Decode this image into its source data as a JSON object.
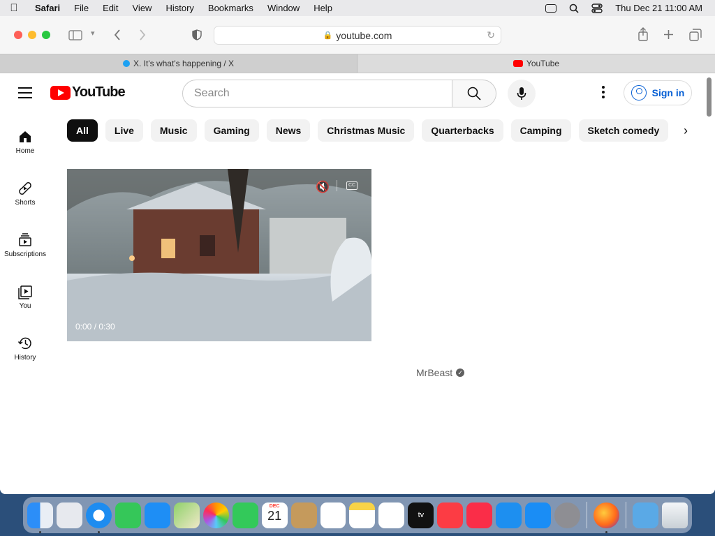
{
  "menubar": {
    "app": "Safari",
    "items": [
      "File",
      "Edit",
      "View",
      "History",
      "Bookmarks",
      "Window",
      "Help"
    ],
    "clock": "Thu Dec 21  11:00 AM"
  },
  "browser": {
    "url": "youtube.com",
    "tabs": [
      {
        "label": "X. It's what's happening / X",
        "active": false
      },
      {
        "label": "YouTube",
        "active": true
      }
    ]
  },
  "youtube": {
    "logo_text": "YouTube",
    "search_placeholder": "Search",
    "signin_label": "Sign in",
    "chips": [
      "All",
      "Live",
      "Music",
      "Gaming",
      "News",
      "Christmas Music",
      "Quarterbacks",
      "Camping",
      "Sketch comedy"
    ],
    "sidebar": [
      {
        "label": "Home",
        "icon": "home-icon"
      },
      {
        "label": "Shorts",
        "icon": "shorts-icon"
      },
      {
        "label": "Subscriptions",
        "icon": "subscriptions-icon"
      },
      {
        "label": "You",
        "icon": "you-icon"
      },
      {
        "label": "History",
        "icon": "history-icon"
      }
    ],
    "video": {
      "timecode": "0:00 / 0:30",
      "channel": "MrBeast"
    }
  },
  "dock": [
    "Finder",
    "Launchpad",
    "Safari",
    "Messages",
    "Mail",
    "Maps",
    "Photos",
    "FaceTime",
    "Calendar",
    "Contacts",
    "Reminders",
    "Notes",
    "Freeform",
    "TV",
    "Music",
    "News",
    "Keynote",
    "App Store",
    "System Settings",
    "Firefox",
    "Downloads",
    "Trash"
  ],
  "calendar_icon": {
    "month": "DEC",
    "day": "21"
  }
}
